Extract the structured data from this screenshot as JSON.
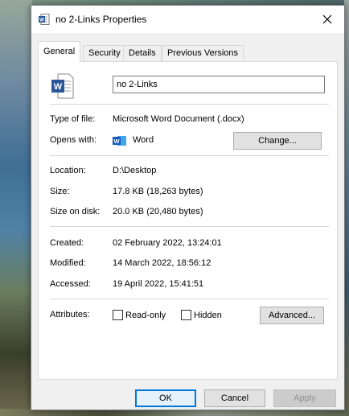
{
  "window": {
    "title": "no 2-Links Properties",
    "close_glyph": "✕"
  },
  "tabs": [
    {
      "label": "General",
      "active": true
    },
    {
      "label": "Security",
      "active": false
    },
    {
      "label": "Details",
      "active": false
    },
    {
      "label": "Previous Versions",
      "active": false
    }
  ],
  "file": {
    "name": "no 2-Links",
    "icon": "word-document-icon"
  },
  "properties": {
    "type_label": "Type of file:",
    "type_value": "Microsoft Word Document (.docx)",
    "opens_label": "Opens with:",
    "opens_value": "Word",
    "change_button": "Change...",
    "location_label": "Location:",
    "location_value": "D:\\Desktop",
    "size_label": "Size:",
    "size_value": "17.8 KB (18,263 bytes)",
    "size_on_disk_label": "Size on disk:",
    "size_on_disk_value": "20.0 KB (20,480 bytes)",
    "created_label": "Created:",
    "created_value": "02 February 2022, 13:24:01",
    "modified_label": "Modified:",
    "modified_value": "14 March 2022, 18:56:12",
    "accessed_label": "Accessed:",
    "accessed_value": "19 April 2022, 15:41:51",
    "attributes_label": "Attributes:",
    "readonly_label": "Read-only",
    "readonly_checked": false,
    "hidden_label": "Hidden",
    "hidden_checked": false,
    "advanced_button": "Advanced..."
  },
  "footer": {
    "ok": "OK",
    "cancel": "Cancel",
    "apply": "Apply"
  },
  "colors": {
    "word_blue": "#2b579a",
    "focus_blue": "#0078d7"
  }
}
